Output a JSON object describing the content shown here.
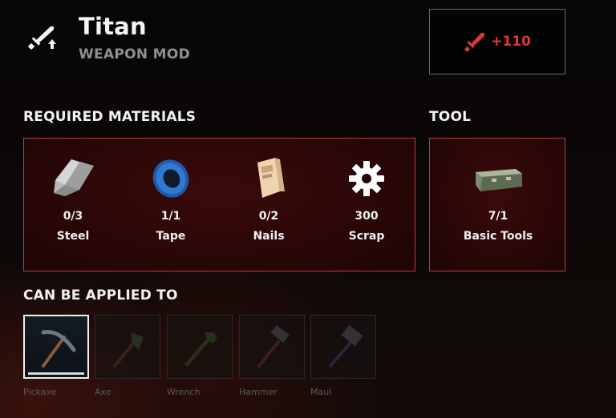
{
  "mod": {
    "title": "Titan",
    "type_label": "WEAPON MOD",
    "icon": "sword-upgrade-icon"
  },
  "stat": {
    "icon": "red-sword-icon",
    "value": "+110",
    "color": "#d93a3a"
  },
  "required_materials": {
    "heading": "REQUIRED MATERIALS",
    "items": [
      {
        "name": "Steel",
        "count": "0/3",
        "icon": "steel-sheet-icon"
      },
      {
        "name": "Tape",
        "count": "1/1",
        "icon": "tape-roll-icon"
      },
      {
        "name": "Nails",
        "count": "0/2",
        "icon": "nails-box-icon"
      },
      {
        "name": "Scrap",
        "count": "300",
        "icon": "scrap-gear-icon"
      }
    ]
  },
  "tool": {
    "heading": "TOOL",
    "name": "Basic Tools",
    "count": "7/1",
    "icon": "toolbox-icon"
  },
  "applied_to": {
    "heading": "CAN BE APPLIED TO",
    "items": [
      {
        "name": "Pickaxe",
        "icon": "pickaxe-icon",
        "selected": true
      },
      {
        "name": "Axe",
        "icon": "axe-icon",
        "selected": false
      },
      {
        "name": "Wrench",
        "icon": "wrench-icon",
        "selected": false
      },
      {
        "name": "Hammer",
        "icon": "hammer-icon",
        "selected": false
      },
      {
        "name": "Maul",
        "icon": "maul-icon",
        "selected": false
      }
    ]
  },
  "colors": {
    "panel_border": "#b54040",
    "panel_fill": "#2a0707",
    "accent_red": "#d93a3a"
  }
}
